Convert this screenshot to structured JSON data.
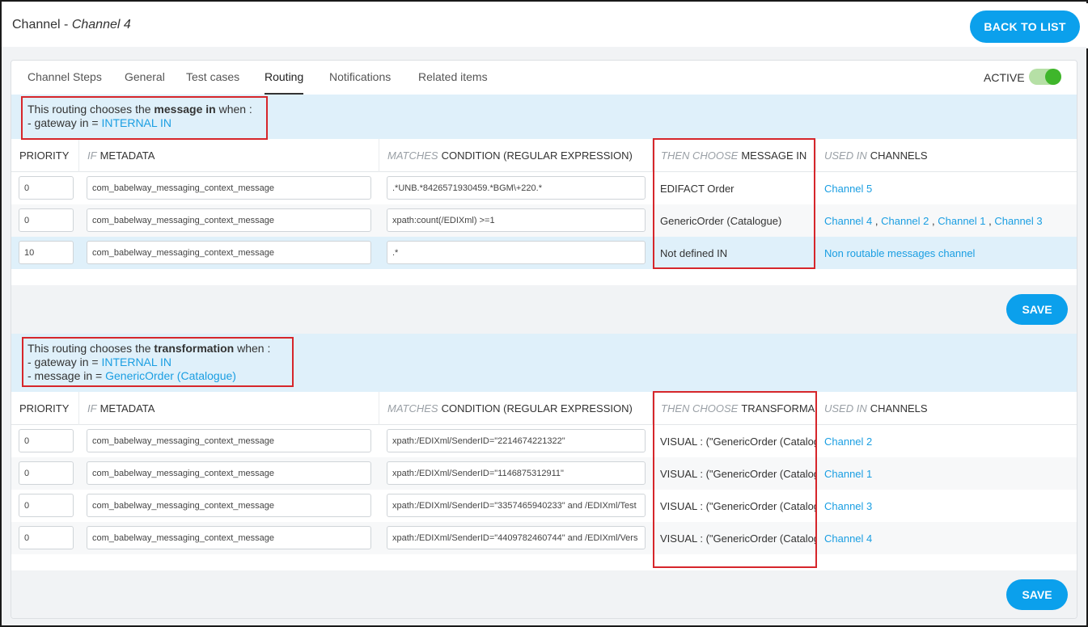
{
  "header": {
    "title_prefix": "Channel - ",
    "title_name": "Channel 4",
    "back_label": "BACK TO LIST"
  },
  "tabs": [
    {
      "label": "Channel Steps"
    },
    {
      "label": "General"
    },
    {
      "label": "Test cases"
    },
    {
      "label": "Routing",
      "active": true
    },
    {
      "label": "Notifications"
    },
    {
      "label": "Related items"
    }
  ],
  "status": {
    "label": "ACTIVE",
    "on": true
  },
  "colors": {
    "accent": "#0ba0ec",
    "link": "#1a9ee2",
    "highlight": "#dff0fa",
    "toggle_on": "#3fb62b",
    "annotation": "#d6262b"
  },
  "section1": {
    "info_pre": "This routing chooses the ",
    "info_bold": "message in",
    "info_post": " when :",
    "cond1_label": "- gateway in = ",
    "cond1_value": "INTERNAL IN",
    "headers": {
      "priority": "PRIORITY",
      "metadata_em": "IF",
      "metadata": "METADATA",
      "condition_em": "MATCHES",
      "condition": "CONDITION (REGULAR EXPRESSION)",
      "choose_em": "THEN CHOOSE",
      "choose": "MESSAGE IN",
      "used_em": "USED IN",
      "used": "CHANNELS"
    },
    "rows": [
      {
        "priority": "0",
        "metadata": "com_babelway_messaging_context_message",
        "condition": ".*UNB.*8426571930459.*BGM\\+220.*",
        "choice": "EDIFACT Order",
        "channels": [
          "Channel 5"
        ]
      },
      {
        "priority": "0",
        "metadata": "com_babelway_messaging_context_message",
        "condition": "xpath:count(/EDIXml) >=1",
        "choice": "GenericOrder (Catalogue)",
        "channels": [
          "Channel 4",
          "Channel 2",
          "Channel 1",
          "Channel 3"
        ]
      },
      {
        "priority": "10",
        "metadata": "com_babelway_messaging_context_message",
        "condition": ".*",
        "choice": "Not defined IN",
        "channels": [
          "Non routable messages channel"
        ]
      }
    ],
    "save_label": "SAVE"
  },
  "section2": {
    "info_pre": "This routing chooses the ",
    "info_bold": "transformation",
    "info_post": " when :",
    "cond1_label": "- gateway in = ",
    "cond1_value": "INTERNAL IN",
    "cond2_label": "- message in = ",
    "cond2_value": "GenericOrder (Catalogue)",
    "headers": {
      "priority": "PRIORITY",
      "metadata_em": "IF",
      "metadata": "METADATA",
      "condition_em": "MATCHES",
      "condition": "CONDITION (REGULAR EXPRESSION)",
      "choose_em": "THEN CHOOSE",
      "choose": "TRANSFORMA",
      "used_em": "USED IN",
      "used": "CHANNELS"
    },
    "rows": [
      {
        "priority": "0",
        "metadata": "com_babelway_messaging_context_message",
        "condition": "xpath:/EDIXml/SenderID=\"2214674221322\"",
        "choice": "VISUAL : (\"GenericOrder (Catalog",
        "channels": [
          "Channel 2"
        ]
      },
      {
        "priority": "0",
        "metadata": "com_babelway_messaging_context_message",
        "condition": "xpath:/EDIXml/SenderID=\"1146875312911\"",
        "choice": "VISUAL : (\"GenericOrder (Catalog",
        "channels": [
          "Channel 1"
        ]
      },
      {
        "priority": "0",
        "metadata": "com_babelway_messaging_context_message",
        "condition": "xpath:/EDIXml/SenderID=\"3357465940233\" and /EDIXml/Test",
        "choice": "VISUAL : (\"GenericOrder (Catalog",
        "channels": [
          "Channel 3"
        ]
      },
      {
        "priority": "0",
        "metadata": "com_babelway_messaging_context_message",
        "condition": "xpath:/EDIXml/SenderID=\"4409782460744\" and /EDIXml/Vers",
        "choice": "VISUAL : (\"GenericOrder (Catalog",
        "channels": [
          "Channel 4"
        ]
      }
    ],
    "save_label": "SAVE"
  }
}
